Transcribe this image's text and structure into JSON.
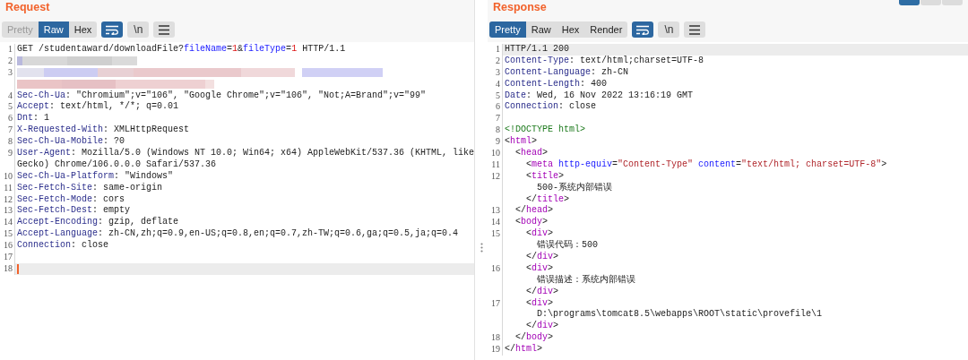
{
  "request": {
    "title": "Request",
    "tabs": [
      {
        "label": "Pretty",
        "selected": false,
        "disabled": true
      },
      {
        "label": "Raw",
        "selected": true,
        "disabled": false
      },
      {
        "label": "Hex",
        "selected": false,
        "disabled": false
      }
    ],
    "wrap_on": true,
    "newline_label": "\\n",
    "rows": [
      {
        "number": "1",
        "kind": "code",
        "highlighted": false,
        "tokens": [
          {
            "kind": "plain",
            "text": "GET /studentaward/downloadFile?"
          },
          {
            "kind": "param",
            "text": "fileName"
          },
          {
            "kind": "plain",
            "text": "="
          },
          {
            "kind": "value",
            "text": "1"
          },
          {
            "kind": "plain",
            "text": "&"
          },
          {
            "kind": "param",
            "text": "fileType"
          },
          {
            "kind": "plain",
            "text": "="
          },
          {
            "kind": "value",
            "text": "1"
          },
          {
            "kind": "plain",
            "text": " HTTP/1.1"
          }
        ]
      },
      {
        "number": "2",
        "kind": "redacted",
        "highlighted": false
      },
      {
        "number": "3",
        "kind": "redacted",
        "highlighted": false
      },
      {
        "kind": "redacted",
        "highlighted": false
      },
      {
        "number": "4",
        "kind": "code",
        "highlighted": false,
        "tokens": [
          {
            "kind": "key",
            "text": "Sec-Ch-Ua"
          },
          {
            "kind": "plain",
            "text": ": \"Chromium\";v=\"106\", \"Google Chrome\";v=\"106\", \"Not;A=Brand\";v=\"99\""
          }
        ]
      },
      {
        "number": "5",
        "kind": "code",
        "highlighted": false,
        "tokens": [
          {
            "kind": "key",
            "text": "Accept"
          },
          {
            "kind": "plain",
            "text": ": text/html, */*; q=0.01"
          }
        ]
      },
      {
        "number": "6",
        "kind": "code",
        "highlighted": false,
        "tokens": [
          {
            "kind": "key",
            "text": "Dnt"
          },
          {
            "kind": "plain",
            "text": ": 1"
          }
        ]
      },
      {
        "number": "7",
        "kind": "code",
        "highlighted": false,
        "tokens": [
          {
            "kind": "key",
            "text": "X-Requested-With"
          },
          {
            "kind": "plain",
            "text": ": XMLHttpRequest"
          }
        ]
      },
      {
        "number": "8",
        "kind": "code",
        "highlighted": false,
        "tokens": [
          {
            "kind": "key",
            "text": "Sec-Ch-Ua-Mobile"
          },
          {
            "kind": "plain",
            "text": ": ?0"
          }
        ]
      },
      {
        "number": "9",
        "kind": "code",
        "highlighted": false,
        "tokens": [
          {
            "kind": "key",
            "text": "User-Agent"
          },
          {
            "kind": "plain",
            "text": ": Mozilla/5.0 (Windows NT 10.0; Win64; x64) AppleWebKit/537.36 (KHTML, like"
          }
        ]
      },
      {
        "kind": "code",
        "highlighted": false,
        "tokens": [
          {
            "kind": "plain",
            "text": "Gecko) Chrome/106.0.0.0 Safari/537.36"
          }
        ]
      },
      {
        "number": "10",
        "kind": "code",
        "highlighted": false,
        "tokens": [
          {
            "kind": "key",
            "text": "Sec-Ch-Ua-Platform"
          },
          {
            "kind": "plain",
            "text": ": \"Windows\""
          }
        ]
      },
      {
        "number": "11",
        "kind": "code",
        "highlighted": false,
        "tokens": [
          {
            "kind": "key",
            "text": "Sec-Fetch-Site"
          },
          {
            "kind": "plain",
            "text": ": same-origin"
          }
        ]
      },
      {
        "number": "12",
        "kind": "code",
        "highlighted": false,
        "tokens": [
          {
            "kind": "key",
            "text": "Sec-Fetch-Mode"
          },
          {
            "kind": "plain",
            "text": ": cors"
          }
        ]
      },
      {
        "number": "13",
        "kind": "code",
        "highlighted": false,
        "tokens": [
          {
            "kind": "key",
            "text": "Sec-Fetch-Dest"
          },
          {
            "kind": "plain",
            "text": ": empty"
          }
        ]
      },
      {
        "number": "14",
        "kind": "code",
        "highlighted": false,
        "tokens": [
          {
            "kind": "key",
            "text": "Accept-Encoding"
          },
          {
            "kind": "plain",
            "text": ": gzip, deflate"
          }
        ]
      },
      {
        "number": "15",
        "kind": "code",
        "highlighted": false,
        "tokens": [
          {
            "kind": "key",
            "text": "Accept-Language"
          },
          {
            "kind": "plain",
            "text": ": zh-CN,zh;q=0.9,en-US;q=0.8,en;q=0.7,zh-TW;q=0.6,ga;q=0.5,ja;q=0.4"
          }
        ]
      },
      {
        "number": "16",
        "kind": "code",
        "highlighted": false,
        "tokens": [
          {
            "kind": "key",
            "text": "Connection"
          },
          {
            "kind": "plain",
            "text": ": close"
          }
        ]
      },
      {
        "number": "17",
        "kind": "code",
        "highlighted": false,
        "tokens": []
      },
      {
        "number": "18",
        "kind": "code",
        "highlighted": true,
        "cursor": true,
        "tokens": []
      }
    ]
  },
  "response": {
    "title": "Response",
    "view_buttons": [
      {
        "selected": true
      },
      {
        "selected": false
      },
      {
        "selected": false
      }
    ],
    "tabs": [
      {
        "label": "Pretty",
        "selected": true,
        "disabled": false
      },
      {
        "label": "Raw",
        "selected": false,
        "disabled": false
      },
      {
        "label": "Hex",
        "selected": false,
        "disabled": false
      },
      {
        "label": "Render",
        "selected": false,
        "disabled": false
      }
    ],
    "wrap_on": true,
    "newline_label": "\\n",
    "rows": [
      {
        "number": "1",
        "kind": "code",
        "highlighted": true,
        "tokens": [
          {
            "kind": "plain",
            "text": "HTTP/1.1 200"
          }
        ]
      },
      {
        "number": "2",
        "kind": "code",
        "highlighted": false,
        "tokens": [
          {
            "kind": "key",
            "text": "Content-Type"
          },
          {
            "kind": "plain",
            "text": ": text/html;charset=UTF-8"
          }
        ]
      },
      {
        "number": "3",
        "kind": "code",
        "highlighted": false,
        "tokens": [
          {
            "kind": "key",
            "text": "Content-Language"
          },
          {
            "kind": "plain",
            "text": ": zh-CN"
          }
        ]
      },
      {
        "number": "4",
        "kind": "code",
        "highlighted": false,
        "tokens": [
          {
            "kind": "key",
            "text": "Content-Length"
          },
          {
            "kind": "plain",
            "text": ": 400"
          }
        ]
      },
      {
        "number": "5",
        "kind": "code",
        "highlighted": false,
        "tokens": [
          {
            "kind": "key",
            "text": "Date"
          },
          {
            "kind": "plain",
            "text": ": Wed, 16 Nov 2022 13:16:19 GMT"
          }
        ]
      },
      {
        "number": "6",
        "kind": "code",
        "highlighted": false,
        "tokens": [
          {
            "kind": "key",
            "text": "Connection"
          },
          {
            "kind": "plain",
            "text": ": close"
          }
        ]
      },
      {
        "number": "7",
        "kind": "code",
        "highlighted": false,
        "tokens": []
      },
      {
        "number": "8",
        "kind": "code",
        "highlighted": false,
        "tokens": [
          {
            "kind": "doctype",
            "text": "<!DOCTYPE html>"
          }
        ]
      },
      {
        "number": "9",
        "kind": "code",
        "highlighted": false,
        "tokens": [
          {
            "kind": "plain",
            "text": "<"
          },
          {
            "kind": "tag",
            "text": "html"
          },
          {
            "kind": "plain",
            "text": ">"
          }
        ]
      },
      {
        "number": "10",
        "kind": "code",
        "highlighted": false,
        "tokens": [
          {
            "kind": "plain",
            "text": "  <"
          },
          {
            "kind": "tag",
            "text": "head"
          },
          {
            "kind": "plain",
            "text": ">"
          }
        ]
      },
      {
        "number": "11",
        "kind": "code",
        "highlighted": false,
        "tokens": [
          {
            "kind": "plain",
            "text": "    <"
          },
          {
            "kind": "tag",
            "text": "meta"
          },
          {
            "kind": "attr",
            "text": " http-equiv"
          },
          {
            "kind": "plain",
            "text": "="
          },
          {
            "kind": "string",
            "text": "\"Content-Type\""
          },
          {
            "kind": "attr",
            "text": " content"
          },
          {
            "kind": "plain",
            "text": "="
          },
          {
            "kind": "string",
            "text": "\"text/html; charset=UTF-8\""
          },
          {
            "kind": "plain",
            "text": ">"
          }
        ]
      },
      {
        "number": "12",
        "kind": "code",
        "highlighted": false,
        "tokens": [
          {
            "kind": "plain",
            "text": "    <"
          },
          {
            "kind": "tag",
            "text": "title"
          },
          {
            "kind": "plain",
            "text": ">"
          }
        ]
      },
      {
        "kind": "code",
        "highlighted": false,
        "tokens": [
          {
            "kind": "plain",
            "text": "      500-系统内部错误"
          }
        ]
      },
      {
        "kind": "code",
        "highlighted": false,
        "tokens": [
          {
            "kind": "plain",
            "text": "    </"
          },
          {
            "kind": "tag",
            "text": "title"
          },
          {
            "kind": "plain",
            "text": ">"
          }
        ]
      },
      {
        "number": "13",
        "kind": "code",
        "highlighted": false,
        "tokens": [
          {
            "kind": "plain",
            "text": "  </"
          },
          {
            "kind": "tag",
            "text": "head"
          },
          {
            "kind": "plain",
            "text": ">"
          }
        ]
      },
      {
        "number": "14",
        "kind": "code",
        "highlighted": false,
        "tokens": [
          {
            "kind": "plain",
            "text": "  <"
          },
          {
            "kind": "tag",
            "text": "body"
          },
          {
            "kind": "plain",
            "text": ">"
          }
        ]
      },
      {
        "number": "15",
        "kind": "code",
        "highlighted": false,
        "tokens": [
          {
            "kind": "plain",
            "text": "    <"
          },
          {
            "kind": "tag",
            "text": "div"
          },
          {
            "kind": "plain",
            "text": ">"
          }
        ]
      },
      {
        "kind": "code",
        "highlighted": false,
        "tokens": [
          {
            "kind": "plain",
            "text": "      错误代码：500"
          }
        ]
      },
      {
        "kind": "code",
        "highlighted": false,
        "tokens": [
          {
            "kind": "plain",
            "text": "    </"
          },
          {
            "kind": "tag",
            "text": "div"
          },
          {
            "kind": "plain",
            "text": ">"
          }
        ]
      },
      {
        "number": "16",
        "kind": "code",
        "highlighted": false,
        "tokens": [
          {
            "kind": "plain",
            "text": "    <"
          },
          {
            "kind": "tag",
            "text": "div"
          },
          {
            "kind": "plain",
            "text": ">"
          }
        ]
      },
      {
        "kind": "code",
        "highlighted": false,
        "tokens": [
          {
            "kind": "plain",
            "text": "      错误描述：系统内部错误"
          }
        ]
      },
      {
        "kind": "code",
        "highlighted": false,
        "tokens": [
          {
            "kind": "plain",
            "text": "    </"
          },
          {
            "kind": "tag",
            "text": "div"
          },
          {
            "kind": "plain",
            "text": ">"
          }
        ]
      },
      {
        "number": "17",
        "kind": "code",
        "highlighted": false,
        "tokens": [
          {
            "kind": "plain",
            "text": "    <"
          },
          {
            "kind": "tag",
            "text": "div"
          },
          {
            "kind": "plain",
            "text": ">"
          }
        ]
      },
      {
        "kind": "code",
        "highlighted": false,
        "tokens": [
          {
            "kind": "plain",
            "text": "      D:\\programs\\tomcat8.5\\webapps\\ROOT\\static\\provefile\\1"
          }
        ]
      },
      {
        "kind": "code",
        "highlighted": false,
        "tokens": [
          {
            "kind": "plain",
            "text": "    </"
          },
          {
            "kind": "tag",
            "text": "div"
          },
          {
            "kind": "plain",
            "text": ">"
          }
        ]
      },
      {
        "number": "18",
        "kind": "code",
        "highlighted": false,
        "tokens": [
          {
            "kind": "plain",
            "text": "  </"
          },
          {
            "kind": "tag",
            "text": "body"
          },
          {
            "kind": "plain",
            "text": ">"
          }
        ]
      },
      {
        "number": "19",
        "kind": "code",
        "highlighted": false,
        "tokens": [
          {
            "kind": "plain",
            "text": "</"
          },
          {
            "kind": "tag",
            "text": "html"
          },
          {
            "kind": "plain",
            "text": ">"
          }
        ]
      }
    ]
  }
}
